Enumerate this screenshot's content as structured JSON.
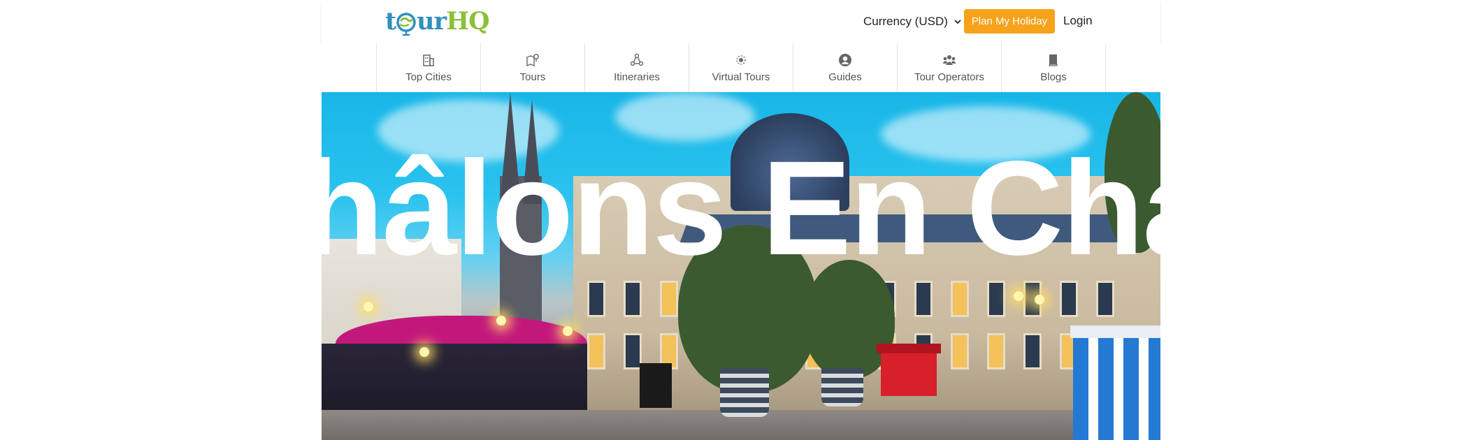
{
  "header": {
    "logo": {
      "part1": "t",
      "part2": "ur",
      "part3": "HQ"
    },
    "currency_label": "Currency (USD)",
    "plan_button": "Plan My Holiday",
    "login": "Login"
  },
  "nav": {
    "items": [
      {
        "label": "Top Cities",
        "icon": "building-icon"
      },
      {
        "label": "Tours",
        "icon": "map-pin-icon"
      },
      {
        "label": "Itineraries",
        "icon": "route-icon"
      },
      {
        "label": "Virtual Tours",
        "icon": "sun-dot-icon"
      },
      {
        "label": "Guides",
        "icon": "user-circle-icon"
      },
      {
        "label": "Tour Operators",
        "icon": "users-icon"
      },
      {
        "label": "Blogs",
        "icon": "book-icon"
      }
    ]
  },
  "hero": {
    "title": "Châlons En Champagne"
  },
  "colors": {
    "accent": "#f7a21b",
    "logo_blue": "#2f8fbf",
    "logo_green": "#8cbf3a"
  }
}
